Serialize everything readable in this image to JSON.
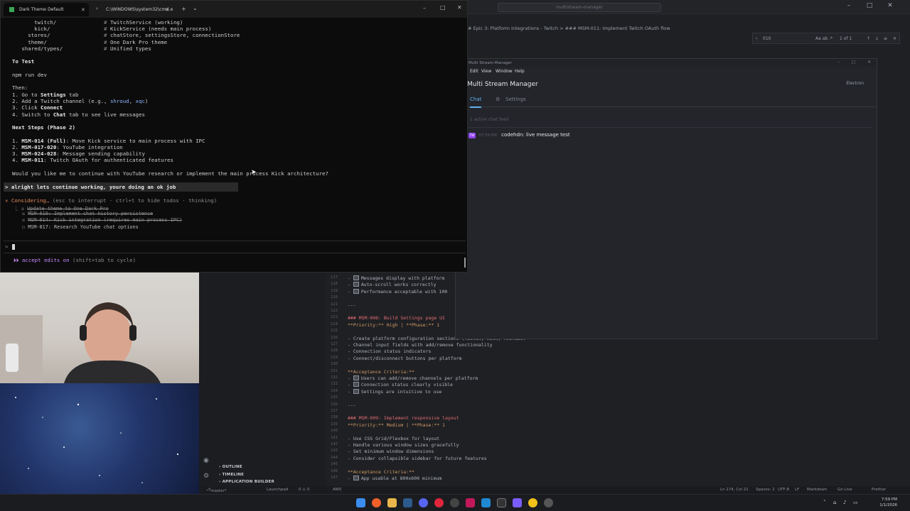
{
  "vscode": {
    "search_placeholder": "multistream-manager",
    "breadcrumb": "# Epic 3: Platform Integrations - Twitch > ### MSM-011: Implement Twitch OAuth flow",
    "find": {
      "query": "010",
      "options": "Aa ab .*",
      "count": "1 of 1"
    },
    "sidebar_sections": [
      "OUTLINE",
      "TIMELINE",
      "APPLICATION BUILDER"
    ],
    "editor_lines": [
      {
        "n": "117",
        "cls": "chk",
        "text": "Messages display with platform"
      },
      {
        "n": "118",
        "cls": "chk",
        "text": "Auto-scroll works correctly"
      },
      {
        "n": "119",
        "cls": "chk",
        "text": "Performance acceptable with 100"
      },
      {
        "n": "120",
        "cls": "blank",
        "text": ""
      },
      {
        "n": "121",
        "cls": "t",
        "text": "---"
      },
      {
        "n": "122",
        "cls": "blank",
        "text": ""
      },
      {
        "n": "123",
        "cls": "h",
        "text": "### MSM-008: Build Settings page UI"
      },
      {
        "n": "124",
        "cls": "o",
        "text": "**Priority:** High | **Phase:** 1"
      },
      {
        "n": "125",
        "cls": "blank",
        "text": ""
      },
      {
        "n": "126",
        "cls": "t",
        "text": "- Create platform configuration sections (Twitch, Kick, YouTube)"
      },
      {
        "n": "127",
        "cls": "t",
        "text": "- Channel input fields with add/remove functionality"
      },
      {
        "n": "128",
        "cls": "t",
        "text": "- Connection status indicators"
      },
      {
        "n": "129",
        "cls": "t",
        "text": "- Connect/disconnect buttons per platform"
      },
      {
        "n": "130",
        "cls": "blank",
        "text": ""
      },
      {
        "n": "131",
        "cls": "o",
        "text": "**Acceptance Criteria:**"
      },
      {
        "n": "132",
        "cls": "chk",
        "text": "Users can add/remove channels per platform"
      },
      {
        "n": "133",
        "cls": "chk",
        "text": "Connection status clearly visible"
      },
      {
        "n": "134",
        "cls": "chk",
        "text": "Settings are intuitive to use"
      },
      {
        "n": "135",
        "cls": "blank",
        "text": ""
      },
      {
        "n": "136",
        "cls": "t",
        "text": "---"
      },
      {
        "n": "137",
        "cls": "blank",
        "text": ""
      },
      {
        "n": "138",
        "cls": "h",
        "text": "### MSM-009: Implement responsive layout"
      },
      {
        "n": "139",
        "cls": "o",
        "text": "**Priority:** Medium | **Phase:** 1"
      },
      {
        "n": "140",
        "cls": "blank",
        "text": ""
      },
      {
        "n": "141",
        "cls": "t",
        "text": "- Use CSS Grid/Flexbox for layout"
      },
      {
        "n": "142",
        "cls": "t",
        "text": "- Handle various window sizes gracefully"
      },
      {
        "n": "143",
        "cls": "t",
        "text": "- Set minimum window dimensions"
      },
      {
        "n": "144",
        "cls": "t",
        "text": "- Consider collapsible sidebar for future features"
      },
      {
        "n": "145",
        "cls": "blank",
        "text": ""
      },
      {
        "n": "146",
        "cls": "o",
        "text": "**Acceptance Criteria:**"
      },
      {
        "n": "147",
        "cls": "chk",
        "text": "App usable at 800x600 minimum"
      }
    ],
    "status": {
      "branch": "master*",
      "launchpad": "Launchpad",
      "problems": "0 ⚠ 0",
      "aws": "AWS",
      "position": "Ln 174, Col 21",
      "spaces": "Spaces: 2",
      "encoding": "UTF-8",
      "eol": "LF",
      "language": "Markdown",
      "golive": "Go Live",
      "prettier": "Prettier"
    }
  },
  "app": {
    "title": "Multi Stream Manager",
    "menu": [
      "Edit",
      "View",
      "Window",
      "Help"
    ],
    "heading": "Multi Stream Manager",
    "badge": "Electron",
    "tabs": [
      "Chat",
      "Settings"
    ],
    "channel_label": "1 active chat feed",
    "message": {
      "platform": "TW",
      "time": "07:59 PM",
      "user": "codehdn",
      "text": "live message test"
    }
  },
  "terminal": {
    "tabs": [
      {
        "label": "Dark Theme Default",
        "active": true
      },
      {
        "label": "C:\\WINDOWS\\system32\\cmd.e",
        "active": false
      }
    ],
    "new_tab": "+",
    "dropdown": "⌄",
    "lines": [
      {
        "y": 30,
        "html": "       twitch/               <span class=\"tgray\">#</span> TwitchService (working)"
      },
      {
        "y": 39,
        "html": "       kick/                 <span class=\"tgray\">#</span> KickService (needs main process)"
      },
      {
        "y": 48,
        "html": "     stores/                 <span class=\"tgray\">#</span> chatStore, settingsStore, connectionStore"
      },
      {
        "y": 58,
        "html": "     theme/                  <span class=\"tgray\">#</span> One Dark Pro theme"
      },
      {
        "y": 67,
        "html": "   shared/types/             <span class=\"tgray\">#</span> Unified types"
      }
    ],
    "to_test": "To Test",
    "cmd": "npm run dev",
    "then": "Then:",
    "steps": [
      "1. Go to Settings tab",
      "2. Add a Twitch channel (e.g., shroud, xqc)",
      "3. Click Connect",
      "4. Switch to Chat tab to see live messages"
    ],
    "next_title": "Next Steps (Phase 2)",
    "next": [
      {
        "id": "MSM-014 (Full)",
        "text": ": Move Kick service to main process with IPC"
      },
      {
        "id": "MSM-017-020",
        "text": ": YouTube integration"
      },
      {
        "id": "MSM-024-028",
        "text": ": Message sending capability"
      },
      {
        "id": "MSM-011",
        "text": ": Twitch OAuth for authenticated features"
      }
    ],
    "question": "Would you like me to continue with YouTube research or implement the main process Kick architecture?",
    "user_prompt": "> alright lets continue working, youre doing an ok job",
    "considering": "Considering…",
    "considering_hint": " (esc to interrupt · ctrl+t to hide todos · thinking)",
    "todos": [
      {
        "done": true,
        "text": "Update theme to One Dark Pro"
      },
      {
        "done": true,
        "text": "MSM-010: Implement chat history persistence"
      },
      {
        "done": true,
        "text": "MSM-014: Kick integration (requires main process IPC)"
      },
      {
        "done": false,
        "text": "MSM-017: Research YouTube chat options"
      }
    ],
    "input_prompt": ">",
    "footer": "⏵⏵ accept edits on",
    "footer_hint": " (shift+tab to cycle)"
  },
  "taskbar": {
    "time": "7:59 PM",
    "date": "1/1/2026"
  },
  "colors": {
    "accent": "#c678dd",
    "twitch": "#9146ff",
    "orange": "#e08a5a"
  }
}
